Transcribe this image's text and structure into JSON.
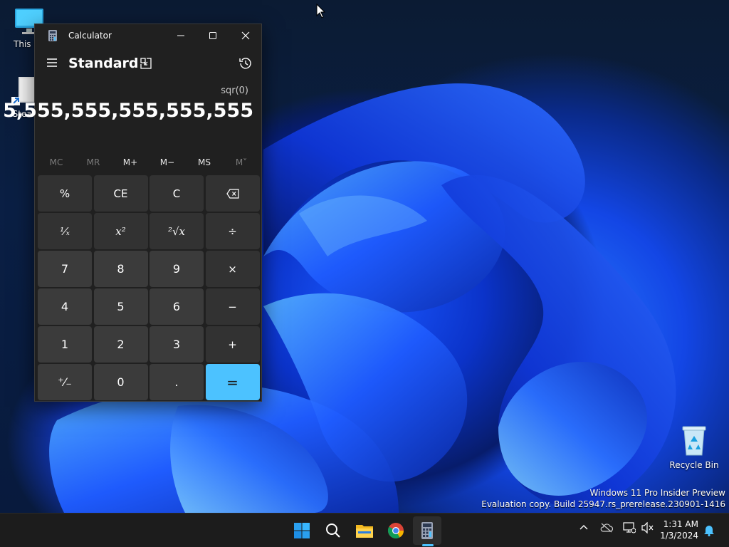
{
  "desktop": {
    "icons": [
      {
        "label": "This PC"
      },
      {
        "label": "Steam"
      },
      {
        "label": "Recycle Bin"
      }
    ],
    "watermark": {
      "line1": "Windows 11 Pro Insider Preview",
      "line2": "Evaluation copy. Build 25947.rs_prerelease.230901-1416"
    }
  },
  "calculator": {
    "title": "Calculator",
    "mode": "Standard",
    "expression": "sqr(0)",
    "display": "5,555,555,555,555,555",
    "memory": [
      "MC",
      "MR",
      "M+",
      "M−",
      "MS",
      "M˅"
    ],
    "keys": {
      "percent": "%",
      "ce": "CE",
      "c": "C",
      "reciprocal": "¹⁄ₓ",
      "square": "x²",
      "sqrt": "²√x",
      "divide": "÷",
      "seven": "7",
      "eight": "8",
      "nine": "9",
      "multiply": "×",
      "four": "4",
      "five": "5",
      "six": "6",
      "minus": "−",
      "one": "1",
      "two": "2",
      "three": "3",
      "plus": "+",
      "negate": "⁺⁄₋",
      "zero": "0",
      "decimal": ".",
      "equals": "="
    },
    "accent_color": "#4cc2ff"
  },
  "taskbar": {
    "time": "1:31 AM",
    "date": "1/3/2024",
    "apps": [
      "start-icon",
      "search-icon",
      "file-explorer-icon",
      "chrome-icon",
      "calculator-icon"
    ]
  }
}
